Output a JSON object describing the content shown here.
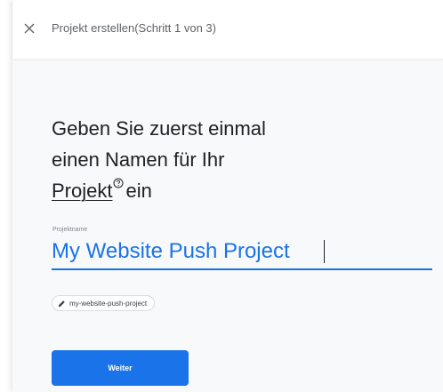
{
  "header": {
    "title": "Projekt erstellen(Schritt 1 von 3)",
    "close_icon": "close-icon"
  },
  "heading": {
    "line1": "Geben Sie zuerst einmal",
    "line2": "einen Namen für Ihr",
    "link": "Projekt",
    "suffix": "ein",
    "help_icon": "help-circle-icon"
  },
  "project_name_field": {
    "label": "Projektname",
    "value": "My Website Push Project"
  },
  "project_id_chip": {
    "icon": "pencil-icon",
    "value": "my-website-push-project"
  },
  "continue_button": {
    "label": "Weiter"
  },
  "colors": {
    "accent": "#1a73e8",
    "panel_background": "#f8f9fa",
    "text_primary": "#202124",
    "text_secondary": "#5f6368"
  }
}
